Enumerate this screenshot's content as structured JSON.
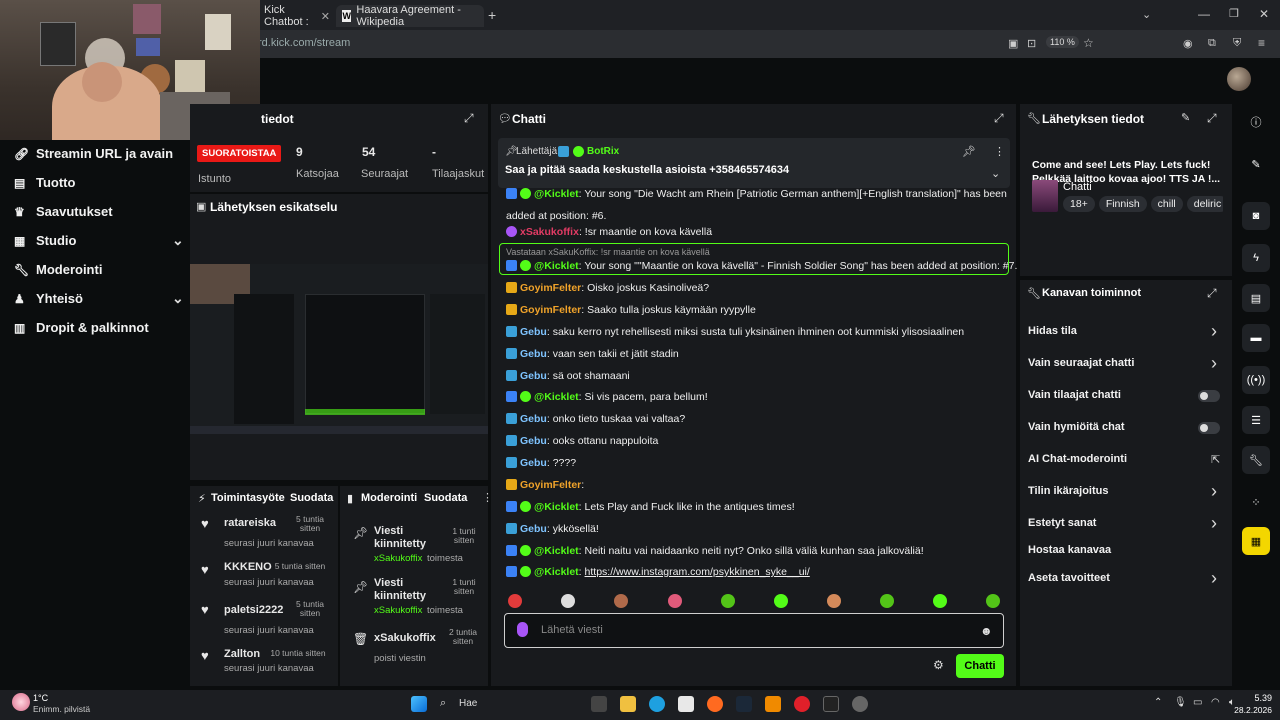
{
  "browser": {
    "tabs": [
      {
        "label": "Kick Chatbot :"
      },
      {
        "label": "Haavara Agreement - Wikipedia"
      }
    ],
    "url": "rd.kick.com/stream",
    "zoom": "110 %"
  },
  "sidebar": {
    "items": [
      {
        "label": "Streamin URL ja avain",
        "icon": "link-icon"
      },
      {
        "label": "Tuotto",
        "icon": "wallet-icon"
      },
      {
        "label": "Saavutukset",
        "icon": "trophy-icon"
      },
      {
        "label": "Studio",
        "icon": "studio-icon"
      },
      {
        "label": "Moderointi",
        "icon": "wrench-icon"
      },
      {
        "label": "Yhteisö",
        "icon": "community-icon"
      },
      {
        "label": "Dropit & palkinnot",
        "icon": "gift-icon"
      }
    ]
  },
  "stats": {
    "title": "tiedot",
    "live_badge": "SUORATOISTAA",
    "session_label": "Istunto",
    "viewers_value": "9",
    "viewers_label": "Katsojaa",
    "followers_value": "54",
    "followers_label": "Seuraajat",
    "subs_value": "-",
    "subs_label": "Tilaajaskut"
  },
  "preview": {
    "title": "Lähetyksen esikatselu"
  },
  "activity": {
    "title": "Toimintasyöte",
    "filter": "Suodata",
    "items": [
      {
        "user": "ratareiska",
        "time": "5 tuntia sitten",
        "action": "seurasi juuri kanavaa"
      },
      {
        "user": "KKKENO",
        "time": "5 tuntia sitten",
        "action": "seurasi juuri kanavaa"
      },
      {
        "user": "paletsi2222",
        "time": "5 tuntia sitten",
        "action": "seurasi juuri kanavaa"
      },
      {
        "user": "Zallton",
        "time": "10 tuntia sitten",
        "action": "seurasi juuri kanavaa"
      }
    ]
  },
  "moderation": {
    "title": "Moderointi",
    "filter": "Suodata",
    "items": [
      {
        "title": "Viesti kiinnitetty",
        "user": "xSakukoffix",
        "action": "toimesta",
        "time": "1 tunti sitten"
      },
      {
        "title": "Viesti kiinnitetty",
        "user": "xSakukoffix",
        "action": "toimesta",
        "time": "1 tunti sitten"
      },
      {
        "title": "xSakukoffix",
        "user": "",
        "action": "poisti viestin",
        "time": "2 tuntia sitten"
      }
    ]
  },
  "chat": {
    "title": "Chatti",
    "pinned": {
      "label": "Lähettäjä",
      "user": "BotRix",
      "text": "Saa ja pitää saada keskustella asioista +358465574634"
    },
    "reply_header": "Vastataan xSakuKoffix: !sr maantie on kova kävellä",
    "messages": [
      {
        "user": "@Kicklet",
        "text": "Your song \"Die Wacht am Rhein [Patriotic German anthem][+English translation]\" has been",
        "cls": "u-green",
        "badge": "b-bot"
      },
      {
        "user": "",
        "text": "added at position: #6.",
        "cls": "",
        "badge": ""
      },
      {
        "user": "xSakukoffix",
        "text": "!sr maantie on kova kävellä",
        "cls": "u-pink",
        "badge": "b-mic"
      },
      {
        "user": "@Kicklet",
        "text": "Your song \"\"Maantie on kova kävellä\" - Finnish Soldier Song\" has been added at position: #7.",
        "cls": "u-green",
        "badge": "b-bot"
      },
      {
        "user": "GoyimFelter",
        "text": "Oisko joskus Kasinoliveä?",
        "cls": "u-gold",
        "badge": "b-crown"
      },
      {
        "user": "GoyimFelter",
        "text": "Saako tulla joskus käymään ryypylle",
        "cls": "u-gold",
        "badge": "b-crown"
      },
      {
        "user": "Gebu",
        "text": "saku kerro nyt rehellisesti miksi susta tuli yksinäinen ihminen oot kummiski ylisosiaalinen",
        "cls": "u-blue",
        "badge": "b-sword"
      },
      {
        "user": "Gebu",
        "text": "vaan sen takii et jätit stadin",
        "cls": "u-blue",
        "badge": "b-sword"
      },
      {
        "user": "Gebu",
        "text": "sä oot shamaani",
        "cls": "u-blue",
        "badge": "b-sword"
      },
      {
        "user": "@Kicklet",
        "text": "Si vis pacem, para bellum!",
        "cls": "u-green",
        "badge": "b-bot"
      },
      {
        "user": "Gebu",
        "text": "onko tieto tuskaa vai valtaa?",
        "cls": "u-blue",
        "badge": "b-sword"
      },
      {
        "user": "Gebu",
        "text": "ooks ottanu nappuloita",
        "cls": "u-blue",
        "badge": "b-sword"
      },
      {
        "user": "Gebu",
        "text": "????",
        "cls": "u-blue",
        "badge": "b-sword"
      },
      {
        "user": "GoyimFelter",
        "text": "",
        "cls": "u-gold",
        "badge": "b-crown"
      },
      {
        "user": "@Kicklet",
        "text": "Lets Play and Fuck like in the antiques times!",
        "cls": "u-green",
        "badge": "b-bot"
      },
      {
        "user": "Gebu",
        "text": "ykkösellä!",
        "cls": "u-blue",
        "badge": "b-sword"
      },
      {
        "user": "@Kicklet",
        "text": "Neiti naitu vai naidaanko neiti nyt? Onko sillä väliä kunhan saa jalkoväliä!",
        "cls": "u-green",
        "badge": "b-bot"
      },
      {
        "user": "@Kicklet",
        "text": "https://www.instagram.com/psykkinen_syke__ui/",
        "cls": "u-green",
        "badge": "b-bot"
      }
    ],
    "input_placeholder": "Lähetä viesti",
    "send_button": "Chatti"
  },
  "stream_info": {
    "title": "Lähetyksen tiedot",
    "stream_title": "Come and see! Lets Play. Lets fuck! Pelkkää laittoo kovaa ajoo! TTS JA !...",
    "category": "Chatti",
    "tags": [
      "18+",
      "Finnish",
      "chill",
      "deliric"
    ]
  },
  "channel_actions": {
    "title": "Kanavan toiminnot",
    "items": [
      {
        "label": "Hidas tila",
        "control": "arrow"
      },
      {
        "label": "Vain seuraajat chatti",
        "control": "arrow"
      },
      {
        "label": "Vain tilaajat chatti",
        "control": "toggle"
      },
      {
        "label": "Vain hymiöitä chat",
        "control": "toggle"
      },
      {
        "label": "AI Chat-moderointi",
        "control": "external"
      },
      {
        "label": "Tilin ikärajoitus",
        "control": "arrow"
      },
      {
        "label": "Estetyt sanat",
        "control": "arrow"
      },
      {
        "label": "Hostaa kanavaa",
        "control": "none"
      },
      {
        "label": "Aseta tavoitteet",
        "control": "arrow"
      }
    ]
  },
  "taskbar": {
    "weather_temp": "1°C",
    "weather_desc": "Enimm. pilvistä",
    "search": "Hae",
    "time": "5.39",
    "date": "28.2.2026"
  },
  "colors": {
    "accent": "#53fc18",
    "live": "#e91916",
    "panel": "#181a1d",
    "bg": "#0b0d0e"
  }
}
